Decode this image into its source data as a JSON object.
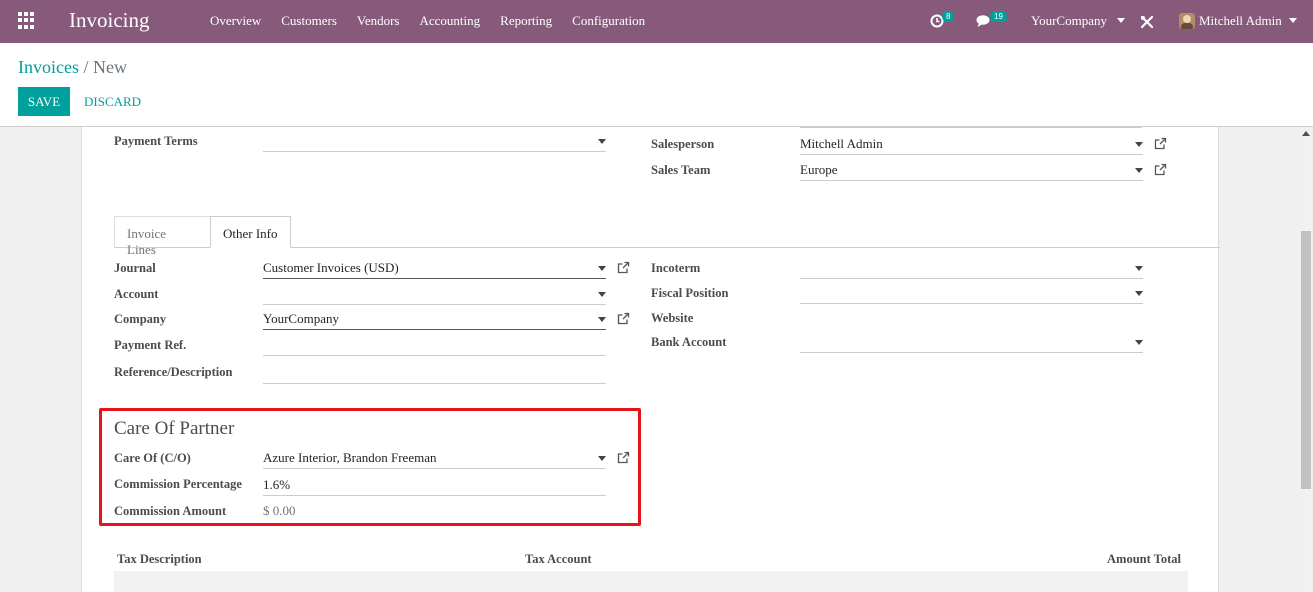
{
  "navbar": {
    "app_name": "Invoicing",
    "menu": [
      "Overview",
      "Customers",
      "Vendors",
      "Accounting",
      "Reporting",
      "Configuration"
    ],
    "activity_count": "8",
    "messages_count": "19",
    "company": "YourCompany",
    "user": "Mitchell Admin"
  },
  "breadcrumb": {
    "parent": "Invoices",
    "separator": "/",
    "current": "New"
  },
  "actions": {
    "save": "SAVE",
    "discard": "DISCARD"
  },
  "top_fields": {
    "payment_terms": {
      "label": "Payment Terms",
      "value": ""
    },
    "salesperson": {
      "label": "Salesperson",
      "value": "Mitchell Admin"
    },
    "sales_team": {
      "label": "Sales Team",
      "value": "Europe"
    }
  },
  "tabs": [
    {
      "label": "Invoice Lines",
      "active": false
    },
    {
      "label": "Other Info",
      "active": true
    }
  ],
  "other_info": {
    "journal": {
      "label": "Journal",
      "value": "Customer Invoices (USD)"
    },
    "account": {
      "label": "Account",
      "value": ""
    },
    "company": {
      "label": "Company",
      "value": "YourCompany"
    },
    "payment_ref": {
      "label": "Payment Ref.",
      "value": ""
    },
    "reference": {
      "label": "Reference/Description",
      "value": ""
    },
    "incoterm": {
      "label": "Incoterm",
      "value": ""
    },
    "fiscal_position": {
      "label": "Fiscal Position",
      "value": ""
    },
    "website": {
      "label": "Website",
      "value": ""
    },
    "bank_account": {
      "label": "Bank Account",
      "value": ""
    }
  },
  "care_of": {
    "title": "Care Of Partner",
    "care_of": {
      "label": "Care Of (C/O)",
      "value": "Azure Interior, Brandon Freeman"
    },
    "commission_percentage": {
      "label": "Commission Percentage",
      "value": "1.6%"
    },
    "commission_amount": {
      "label": "Commission Amount",
      "value": "$ 0.00"
    },
    "highlight_color": "#e3141b"
  },
  "tax_table": {
    "headers": [
      "Tax Description",
      "Tax Account",
      "Amount Total"
    ]
  },
  "colors": {
    "brand": "#875a7b",
    "accent": "#00a09d"
  }
}
